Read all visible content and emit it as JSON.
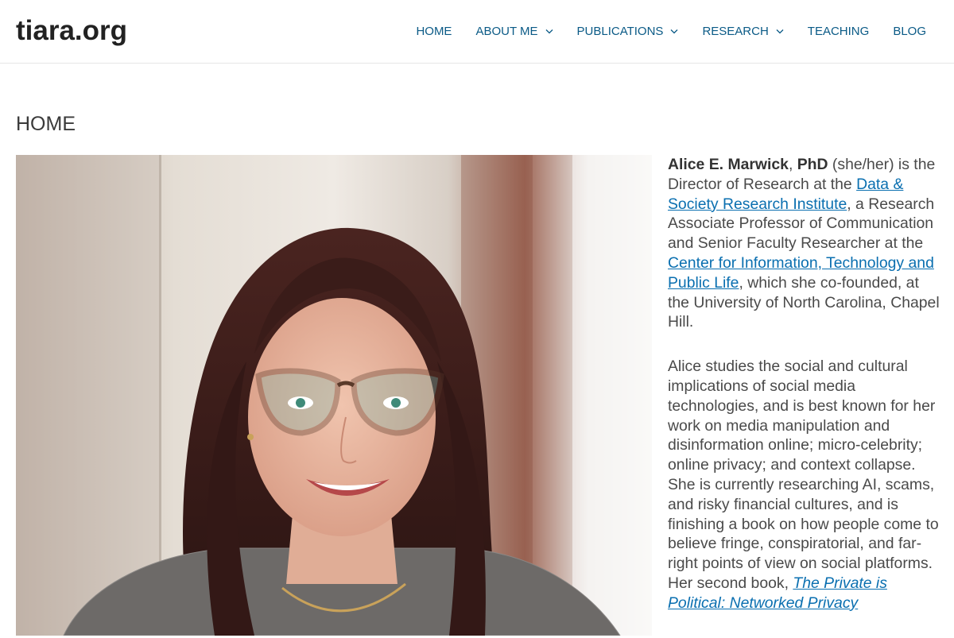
{
  "header": {
    "site_title": "tiara.org",
    "nav": [
      {
        "label": "HOME",
        "has_dropdown": false
      },
      {
        "label": "ABOUT ME",
        "has_dropdown": true
      },
      {
        "label": "PUBLICATIONS",
        "has_dropdown": true
      },
      {
        "label": "RESEARCH",
        "has_dropdown": true
      },
      {
        "label": "TEACHING",
        "has_dropdown": false
      },
      {
        "label": "BLOG",
        "has_dropdown": false
      }
    ]
  },
  "page": {
    "title": "HOME"
  },
  "bio": {
    "name": "Alice E. Marwick",
    "sep": ", ",
    "degree": "PhD",
    "p1_a": " (she/her) is the Director of Research at the ",
    "link_datasociety": "Data & Society Research Institute",
    "p1_b": ", a Research Associate Professor of Communication and Senior Faculty Researcher at the ",
    "link_citap": "Center for Information, Technology and Public Life",
    "p1_c": ", which she co-founded, at the University of North Carolina, Chapel Hill.",
    "p2_a": "Alice studies the social and cultural implications of social media technologies, and is best known for her work on media manipulation and disinformation online; micro-celebrity; online privacy; and context collapse. She is currently researching AI, scams, and risky financial cultures, and is finishing a book on how people come to believe fringe, conspiratorial, and far-right points of view on social platforms. Her second book, ",
    "link_book": "The Private is Political: Networked Privacy"
  },
  "colors": {
    "nav_link": "#0a5a86",
    "body_link": "#0a6fb0",
    "text": "#4a4a4a",
    "header_border": "#e6e6e6"
  },
  "icons": {
    "dropdown": "chevron-down-icon"
  }
}
